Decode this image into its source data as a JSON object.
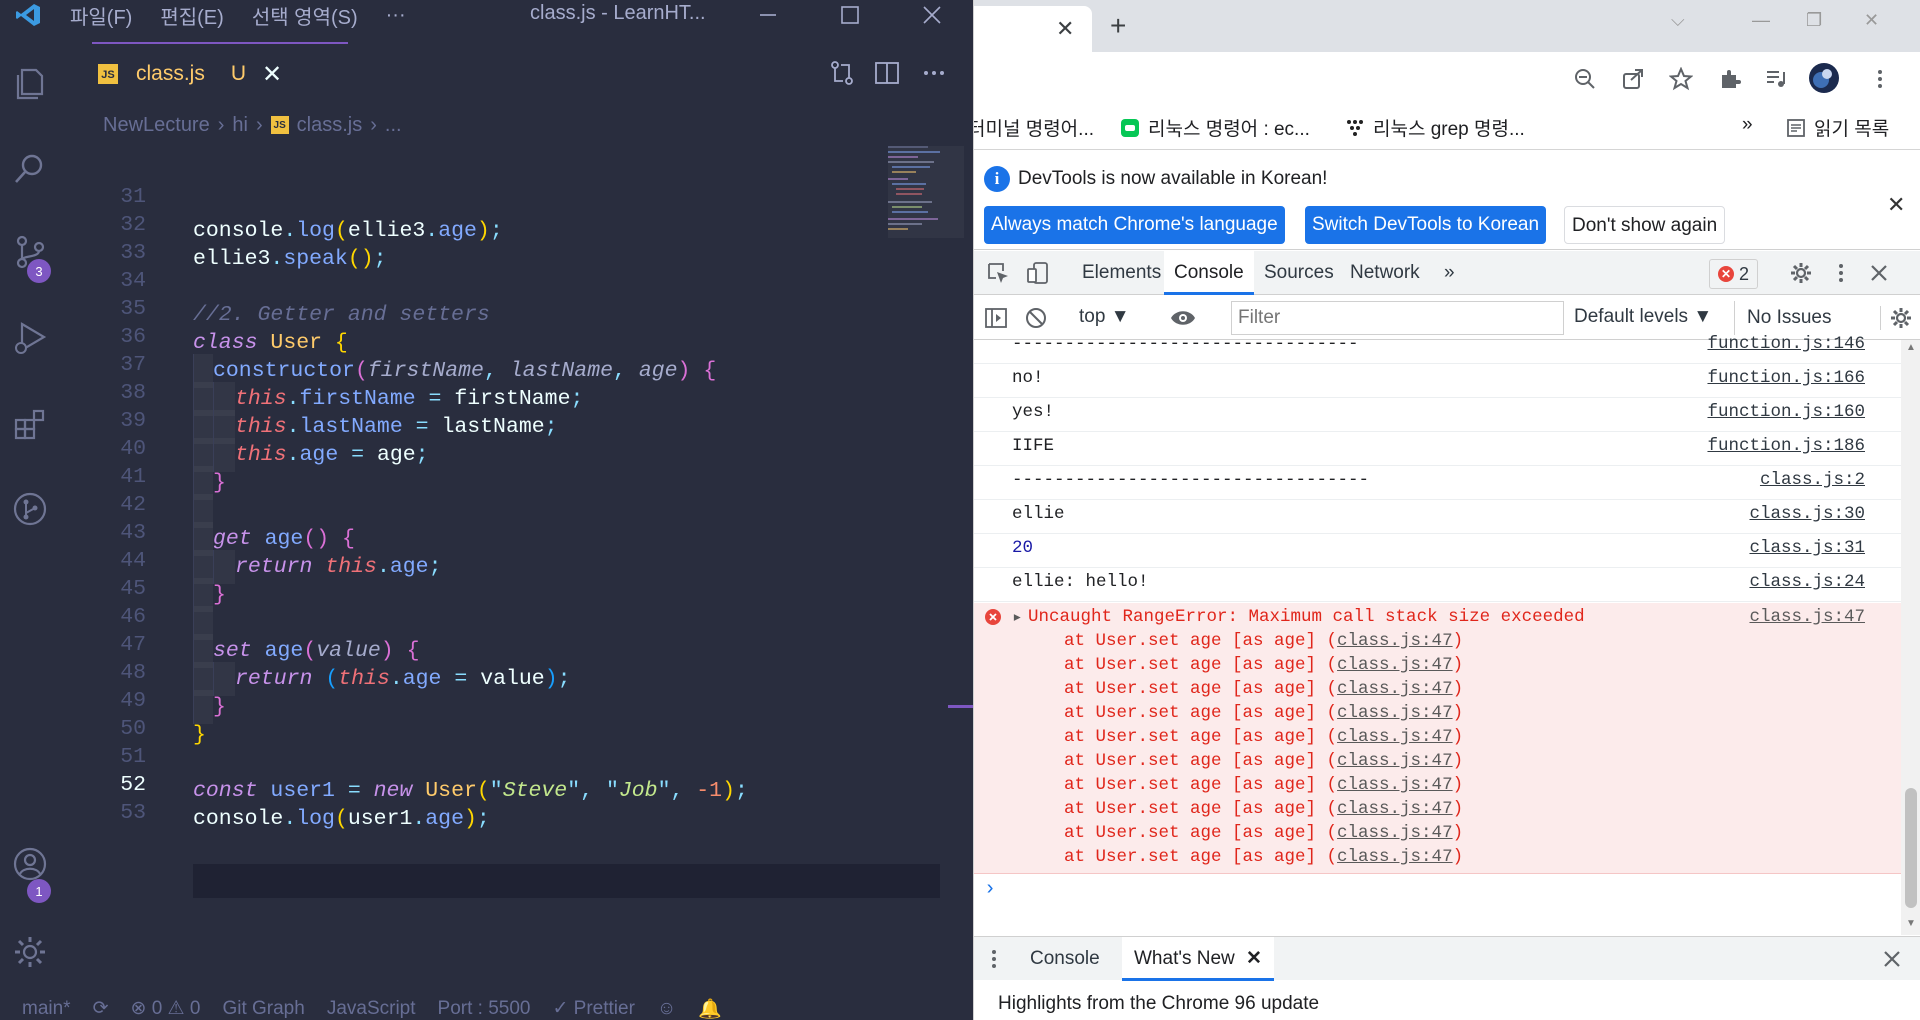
{
  "vscode": {
    "menus": [
      "파일(F)",
      "편집(E)",
      "선택 영역(S)",
      "···"
    ],
    "window_title": "class.js - LearnHT...",
    "tab": {
      "file": "class.js",
      "badge": "JS",
      "status": "U",
      "close": "✕"
    },
    "breadcrumb": [
      "NewLecture",
      "hi",
      "class.js",
      "..."
    ],
    "activity_badges": {
      "source_control": "3",
      "accounts": "1"
    },
    "current_line": "52",
    "line_numbers": [
      "31",
      "32",
      "33",
      "34",
      "35",
      "36",
      "37",
      "38",
      "39",
      "40",
      "41",
      "42",
      "43",
      "44",
      "45",
      "46",
      "47",
      "48",
      "49",
      "50",
      "51",
      "52",
      "53"
    ],
    "code": {
      "l31": [
        "console",
        ".",
        "log",
        "(",
        "ellie3",
        ".",
        "age",
        ")",
        ";"
      ],
      "l32": [
        "ellie3",
        ".",
        "speak",
        "()",
        ";"
      ],
      "l34": [
        "//2. Getter and setters"
      ],
      "l35": [
        "class",
        " ",
        "User",
        " {"
      ],
      "l36": [
        "constructor",
        "(",
        "firstName",
        ", ",
        "lastName",
        ", ",
        "age",
        ")",
        " {"
      ],
      "l37": [
        "this",
        ".",
        "firstName",
        " = ",
        "firstName",
        ";"
      ],
      "l38": [
        "this",
        ".",
        "lastName",
        " = ",
        "lastName",
        ";"
      ],
      "l39": [
        "this",
        ".",
        "age",
        " = ",
        "age",
        ";"
      ],
      "l40": [
        "}"
      ],
      "l42": [
        "get",
        " ",
        "age",
        "()",
        " {"
      ],
      "l43": [
        "return",
        " ",
        "this",
        ".",
        "age",
        ";"
      ],
      "l44": [
        "}"
      ],
      "l46": [
        "set",
        " ",
        "age",
        "(",
        "value",
        ")",
        " {"
      ],
      "l47": [
        "return",
        " ",
        "(",
        "this",
        ".",
        "age",
        " = ",
        "value",
        ")",
        ";"
      ],
      "l48": [
        "}"
      ],
      "l49": [
        "}"
      ],
      "l51": [
        "const",
        " ",
        "user1",
        " = ",
        "new",
        " ",
        "User",
        "(",
        "\"",
        "Steve",
        "\"",
        ", ",
        "\"",
        "Job",
        "\"",
        ", ",
        "-1",
        ")",
        ";"
      ],
      "l52": [
        "console",
        ".",
        "log",
        "(",
        "user1",
        ".",
        "age",
        ")",
        ";"
      ]
    },
    "statusbar": [
      "main*",
      "⊗ 0 ⚠ 0",
      "Git Graph",
      "JavaScript",
      "Port : 5500",
      "✓ Prettier"
    ]
  },
  "chrome": {
    "tab_close": "✕",
    "new_tab": "+",
    "bookmarks": [
      "터미널 명령어...",
      "리눅스 명령어 : ec...",
      "리눅스 grep 명령...",
      "»",
      "읽기 목록"
    ],
    "devtools": {
      "info_text": "DevTools is now available in Korean!",
      "info_buttons": [
        "Always match Chrome's language",
        "Switch DevTools to Korean",
        "Don't show again"
      ],
      "tabs": [
        "Elements",
        "Console",
        "Sources",
        "Network",
        "»"
      ],
      "active_tab": "Console",
      "error_count": "2",
      "context": "top ▼",
      "filter_placeholder": "Filter",
      "levels": "Default levels ▼",
      "issues": "No Issues",
      "messages": [
        {
          "text": "---------------------------------",
          "src": "function.js:146"
        },
        {
          "text": "no!",
          "src": "function.js:166"
        },
        {
          "text": "yes!",
          "src": "function.js:160"
        },
        {
          "text": "IIFE",
          "src": "function.js:186"
        },
        {
          "text": "----------------------------------",
          "src": "class.js:2"
        },
        {
          "text": "ellie",
          "src": "class.js:30"
        },
        {
          "text": "20",
          "src": "class.js:31"
        },
        {
          "text": "ellie: hello!",
          "src": "class.js:24"
        }
      ],
      "error": {
        "title": "Uncaught RangeError: Maximum call stack size exceeded",
        "src": "class.js:47",
        "frame_prefix": "at User.set age [as age] (",
        "frame_link": "class.js:47",
        "frame_suffix": ")"
      },
      "prompt": "›",
      "drawer_tabs": [
        "Console",
        "What's New"
      ],
      "drawer_active": "What's New",
      "drawer_text": "Highlights from the Chrome 96 update"
    }
  },
  "colors": {
    "vscode_bg": "#292d3e",
    "accent": "#7e57c2",
    "chrome_blue": "#1a73e8",
    "error_red": "#e0261b"
  }
}
